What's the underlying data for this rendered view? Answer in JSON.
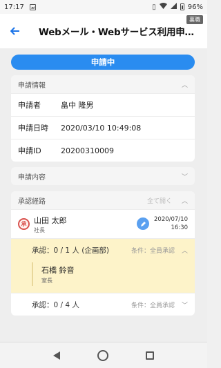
{
  "status_bar": {
    "time": "17:17",
    "battery": "96%"
  },
  "header": {
    "title": "Webメール・Webサービス利用申…",
    "badge": "裏職"
  },
  "status": {
    "label": "申請中"
  },
  "application_info": {
    "section_title": "申請情報",
    "rows": [
      {
        "label": "申請者",
        "value": "畠中 隆男"
      },
      {
        "label": "申請日時",
        "value": "2020/03/10 10:49:08"
      },
      {
        "label": "申請ID",
        "value": "20200310009"
      }
    ]
  },
  "application_content": {
    "section_title": "申請内容"
  },
  "approval_route": {
    "section_title": "承認経路",
    "open_all_label": "全て開く",
    "approver": {
      "seal": "承認",
      "name": "山田 太郎",
      "role": "社長",
      "date": "2020/07/10",
      "time": "16:30"
    },
    "steps": [
      {
        "label": "承認：0 / 1 人 (企画部)",
        "condition": "条件：全員承認",
        "expanded": true,
        "members": [
          {
            "name": "石橋 鈴音",
            "role": "室長"
          }
        ]
      },
      {
        "label": "承認：0 / 4 人",
        "condition": "条件：全員承認",
        "expanded": false
      }
    ]
  },
  "colors": {
    "accent": "#2a8cf0",
    "active_step_bg": "#fdf3c9",
    "seal_red": "#d9534f"
  },
  "icons": {
    "back": "arrow-left-icon",
    "chevron_up": "chevron-up-icon",
    "chevron_down": "chevron-down-icon",
    "edit": "pencil-icon"
  }
}
